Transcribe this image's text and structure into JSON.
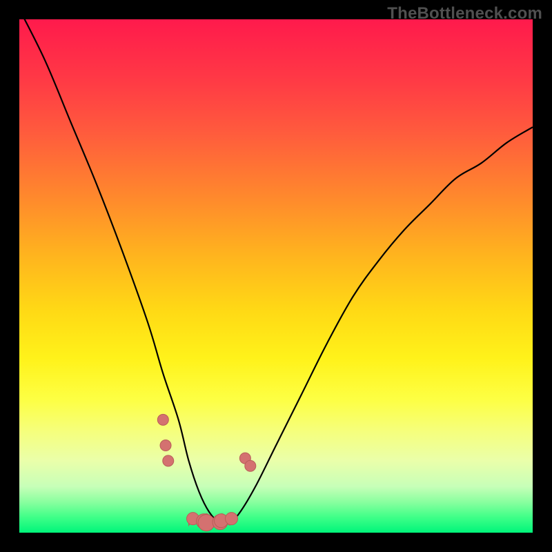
{
  "watermark": "TheBottleneck.com",
  "chart_data": {
    "type": "line",
    "title": "",
    "xlabel": "",
    "ylabel": "",
    "xlim": [
      0,
      100
    ],
    "ylim": [
      0,
      100
    ],
    "series": [
      {
        "name": "curve",
        "x": [
          0,
          5,
          10,
          15,
          20,
          25,
          28,
          31,
          33,
          35,
          37,
          39,
          41,
          43,
          46,
          50,
          55,
          60,
          65,
          70,
          75,
          80,
          85,
          90,
          95,
          100
        ],
        "values": [
          102,
          92,
          80,
          68,
          55,
          41,
          31,
          22,
          14,
          8,
          4,
          2,
          2,
          4,
          9,
          17,
          27,
          37,
          46,
          53,
          59,
          64,
          69,
          72,
          76,
          79
        ]
      }
    ],
    "annotations": {
      "markers": [
        {
          "x": 28.0,
          "y": 22.0,
          "kind": "dot"
        },
        {
          "x": 28.5,
          "y": 17.0,
          "kind": "dot"
        },
        {
          "x": 29.0,
          "y": 14.0,
          "kind": "dot"
        },
        {
          "x": 44.0,
          "y": 14.5,
          "kind": "dot"
        },
        {
          "x": 45.0,
          "y": 13.0,
          "kind": "dot"
        }
      ],
      "trough_blob": {
        "x_start": 33,
        "x_end": 42,
        "y": 3
      }
    },
    "colors": {
      "gradient_top": "#ff1a4c",
      "gradient_mid": "#fff21a",
      "gradient_bottom": "#00f57a",
      "curve": "#000000",
      "marker_fill": "#d47170",
      "marker_stroke": "#b85d58",
      "frame": "#000000",
      "watermark": "#505050"
    }
  }
}
